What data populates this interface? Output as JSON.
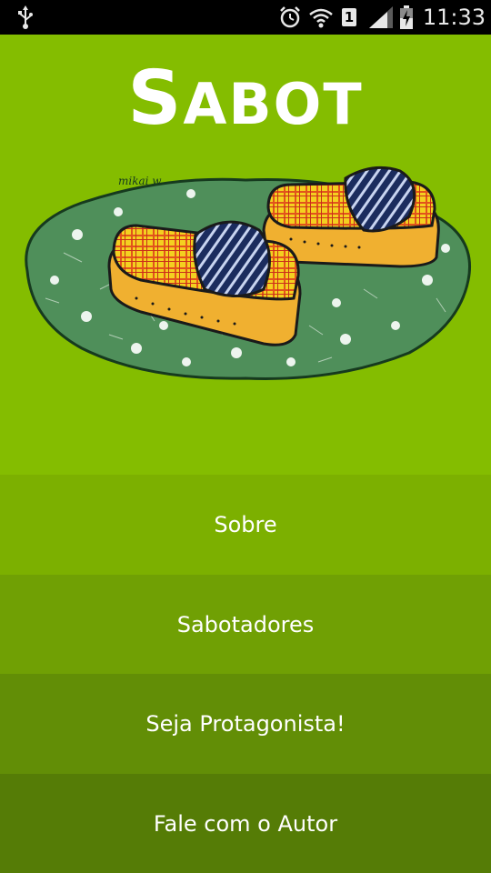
{
  "status_bar": {
    "time": "11:33",
    "sim_slot": "1",
    "icons": [
      "usb-icon",
      "alarm-icon",
      "wifi-icon",
      "sim-icon",
      "signal-icon",
      "battery-icon"
    ]
  },
  "header": {
    "title_first": "S",
    "title_rest": "ABOT",
    "illustration": "sandals-illustration",
    "signature": "mikai w."
  },
  "menu": {
    "items": [
      {
        "label": "Sobre"
      },
      {
        "label": "Sabotadores"
      },
      {
        "label": "Seja Protagonista!"
      },
      {
        "label": "Fale com o Autor"
      }
    ]
  },
  "colors": {
    "header_bg": "#84bd00",
    "menu_1": "#7cb000",
    "menu_2": "#70a004",
    "menu_3": "#628e06",
    "menu_4": "#557c06",
    "mat_green": "#4f8f5a",
    "sandal_sole": "#f0b030",
    "plaid": "#f4d020",
    "strap_blue": "#1a2a5a"
  }
}
